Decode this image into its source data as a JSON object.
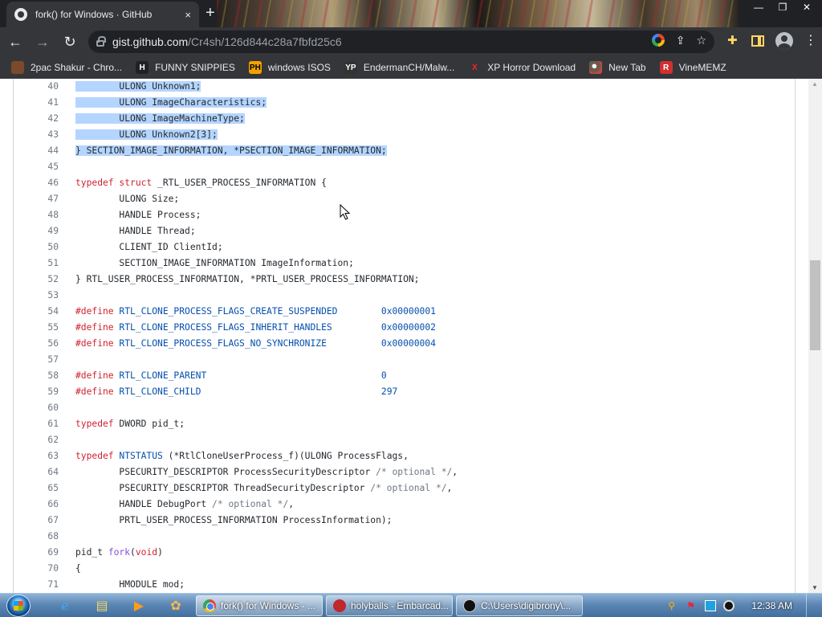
{
  "window": {
    "tab_title": "fork() for Windows · GitHub",
    "close_glyph": "×",
    "newtab_glyph": "+"
  },
  "toolbar": {
    "back": "←",
    "forward": "→",
    "reload": "↻",
    "url_host": "gist.github.com",
    "url_path": "/Cr4sh/126d844c28a7fbfd25c6"
  },
  "bookmarks": [
    {
      "label": "2pac Shakur - Chro...",
      "icon": "H"
    },
    {
      "label": "FUNNY SNIPPIES",
      "icon": "H"
    },
    {
      "label": "windows ISOS",
      "icon": "PH"
    },
    {
      "label": "EndermanCH/Malw...",
      "icon": "YP"
    },
    {
      "label": "XP Horror Download",
      "icon": "X"
    },
    {
      "label": "New Tab",
      "icon": ""
    },
    {
      "label": "VineMEMZ",
      "icon": "R"
    }
  ],
  "code_lines": [
    {
      "n": "40",
      "html": "        ULONG Unknown1;",
      "sel": true
    },
    {
      "n": "41",
      "html": "        ULONG ImageCharacteristics;",
      "sel": true
    },
    {
      "n": "42",
      "html": "        ULONG ImageMachineType;",
      "sel": true
    },
    {
      "n": "43",
      "html": "        ULONG Unknown2[3];",
      "sel": true
    },
    {
      "n": "44",
      "html": "} SECTION_IMAGE_INFORMATION, *PSECTION_IMAGE_INFORMATION;",
      "sel": true
    },
    {
      "n": "45",
      "html": ""
    },
    {
      "n": "46",
      "html": "<span class=\"kw\">typedef</span> <span class=\"kw\">struct</span> _RTL_USER_PROCESS_INFORMATION {"
    },
    {
      "n": "47",
      "html": "        ULONG Size;"
    },
    {
      "n": "48",
      "html": "        HANDLE Process;"
    },
    {
      "n": "49",
      "html": "        HANDLE Thread;"
    },
    {
      "n": "50",
      "html": "        CLIENT_ID ClientId;"
    },
    {
      "n": "51",
      "html": "        SECTION_IMAGE_INFORMATION ImageInformation;"
    },
    {
      "n": "52",
      "html": "} RTL_USER_PROCESS_INFORMATION, *PRTL_USER_PROCESS_INFORMATION;"
    },
    {
      "n": "53",
      "html": ""
    },
    {
      "n": "54",
      "html": "<span class=\"kw\">#define</span> <span class=\"mc\">RTL_CLONE_PROCESS_FLAGS_CREATE_SUSPENDED</span>        <span class=\"mc\">0x00000001</span>"
    },
    {
      "n": "55",
      "html": "<span class=\"kw\">#define</span> <span class=\"mc\">RTL_CLONE_PROCESS_FLAGS_INHERIT_HANDLES</span>         <span class=\"mc\">0x00000002</span>"
    },
    {
      "n": "56",
      "html": "<span class=\"kw\">#define</span> <span class=\"mc\">RTL_CLONE_PROCESS_FLAGS_NO_SYNCHRONIZE</span>          <span class=\"mc\">0x00000004</span>"
    },
    {
      "n": "57",
      "html": ""
    },
    {
      "n": "58",
      "html": "<span class=\"kw\">#define</span> <span class=\"mc\">RTL_CLONE_PARENT</span>                                <span class=\"mc\">0</span>"
    },
    {
      "n": "59",
      "html": "<span class=\"kw\">#define</span> <span class=\"mc\">RTL_CLONE_CHILD</span>                                 <span class=\"mc\">297</span>"
    },
    {
      "n": "60",
      "html": ""
    },
    {
      "n": "61",
      "html": "<span class=\"kw\">typedef</span> DWORD pid_t;"
    },
    {
      "n": "62",
      "html": ""
    },
    {
      "n": "63",
      "html": "<span class=\"kw\">typedef</span> <span class=\"mc\">NTSTATUS</span> (*RtlCloneUserProcess_f)(ULONG ProcessFlags,"
    },
    {
      "n": "64",
      "html": "        PSECURITY_DESCRIPTOR ProcessSecurityDescriptor <span class=\"cm\">/* optional */</span>,"
    },
    {
      "n": "65",
      "html": "        PSECURITY_DESCRIPTOR ThreadSecurityDescriptor <span class=\"cm\">/* optional */</span>,"
    },
    {
      "n": "66",
      "html": "        HANDLE DebugPort <span class=\"cm\">/* optional */</span>,"
    },
    {
      "n": "67",
      "html": "        PRTL_USER_PROCESS_INFORMATION ProcessInformation);"
    },
    {
      "n": "68",
      "html": ""
    },
    {
      "n": "69",
      "html": "pid_t <span class=\"fn\">fork</span>(<span class=\"kw\">void</span>)"
    },
    {
      "n": "70",
      "html": "{"
    },
    {
      "n": "71",
      "html": "        HMODULE mod;"
    }
  ],
  "taskbar": {
    "tasks": [
      {
        "label": "fork() for Windows - ...",
        "icon": "chrome"
      },
      {
        "label": "holyballs - Embarcad...",
        "icon": "embarcadero"
      },
      {
        "label": "C:\\Users\\digibrony\\...",
        "icon": "cmd"
      }
    ],
    "clock": "12:38 AM"
  },
  "colors": {
    "selection": "#b4d5fe",
    "keyword": "#cf222e",
    "macro": "#0550ae",
    "comment": "#6e7781"
  }
}
